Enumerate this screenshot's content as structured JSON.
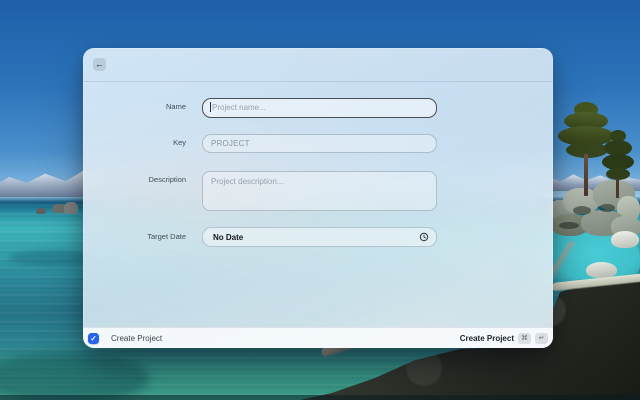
{
  "colors": {
    "accent_blue": "#2563eb",
    "dialog_tint": "#dfeef8",
    "sky_blue": "#2d74bb",
    "water_teal": "#2f9fae"
  },
  "toolbar": {
    "back_glyph": "←"
  },
  "form": {
    "name": {
      "label": "Name",
      "placeholder": "Project name...",
      "value": ""
    },
    "key": {
      "label": "Key",
      "value": "PROJECT"
    },
    "description": {
      "label": "Description",
      "placeholder": "Project description...",
      "value": ""
    },
    "target_date": {
      "label": "Target Date",
      "value": "No Date"
    }
  },
  "footer": {
    "checkbox_checked": true,
    "check_glyph": "✓",
    "checkbox_label": "Create Project",
    "submit_label": "Create Project",
    "shortcut_keys": [
      "⌘",
      "↵"
    ]
  }
}
